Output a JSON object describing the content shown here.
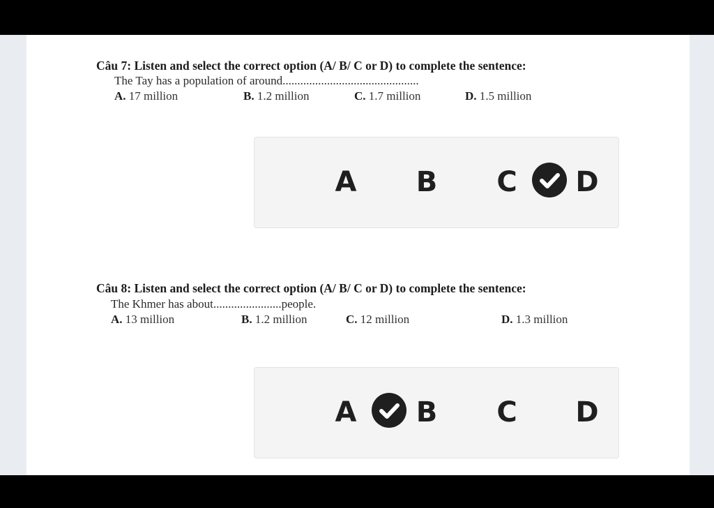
{
  "q7": {
    "title": "Câu 7: Listen and select the correct option (A/ B/ C or D) to complete the sentence:",
    "sentence": "The Tay has a population of around..............................................",
    "options": [
      {
        "letter": "A.",
        "text": " 17 million"
      },
      {
        "letter": "B.",
        "text": " 1.2 million"
      },
      {
        "letter": "C.",
        "text": " 1.7 million"
      },
      {
        "letter": "D.",
        "text": " 1.5 million"
      }
    ],
    "choices": [
      "A",
      "B",
      "C",
      "D"
    ],
    "selected": "D"
  },
  "q8": {
    "title": "Câu 8: Listen and select the correct option (A/ B/ C or D) to complete the sentence:",
    "sentence": "The Khmer has about.......................people.",
    "options": [
      {
        "letter": "A.",
        "text": " 13 million"
      },
      {
        "letter": "B.",
        "text": " 1.2 million"
      },
      {
        "letter": "C.",
        "text": " 12 million"
      },
      {
        "letter": "D.",
        "text": " 1.3 million"
      }
    ],
    "choices": [
      "A",
      "B",
      "C",
      "D"
    ],
    "selected": "B"
  },
  "icons": {
    "selected_marker": "check-circle-icon"
  },
  "colors": {
    "marker": "#1f1f1f",
    "panel": "#f4f4f4"
  }
}
